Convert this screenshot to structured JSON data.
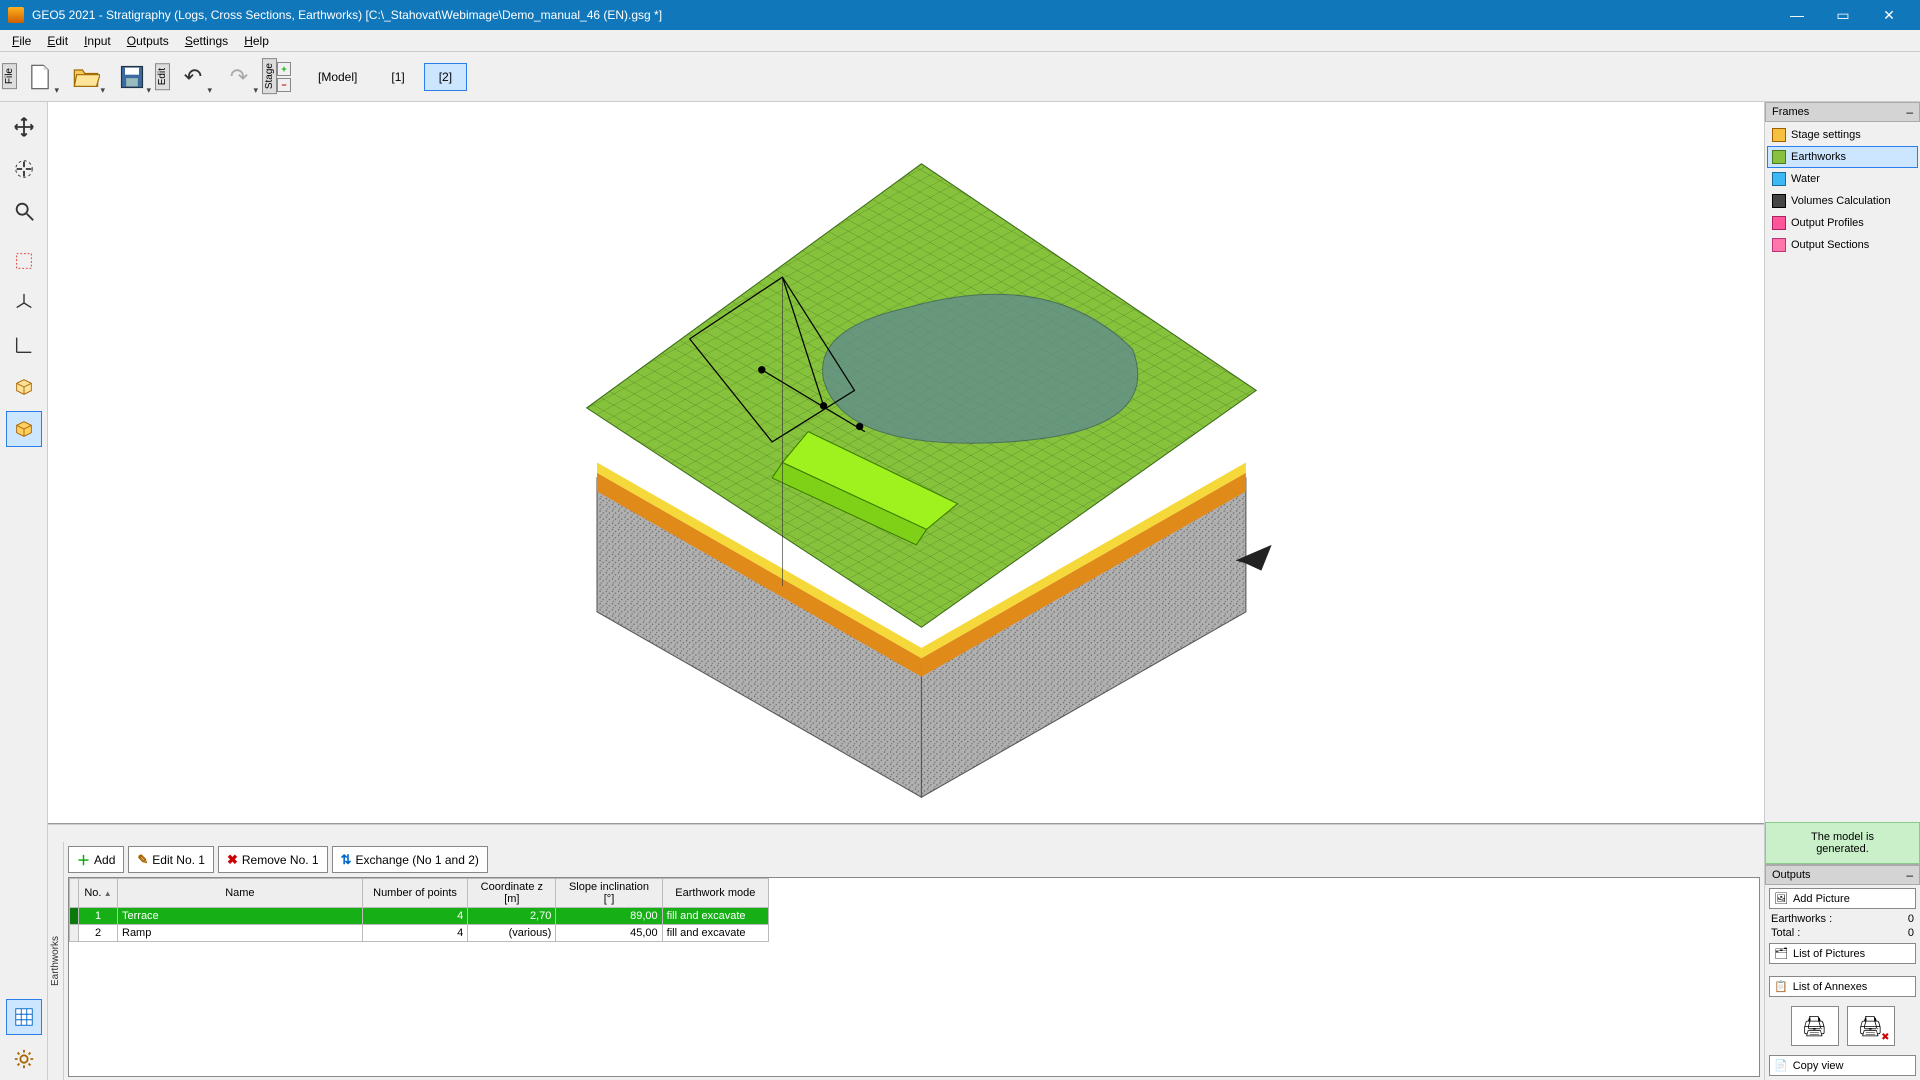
{
  "title": "GEO5 2021 - Stratigraphy (Logs, Cross Sections, Earthworks) [C:\\_Stahovat\\Webimage\\Demo_manual_46 (EN).gsg *]",
  "menu": {
    "file": "File",
    "edit": "Edit",
    "input": "Input",
    "outputs": "Outputs",
    "settings": "Settings",
    "help": "Help"
  },
  "toolbar": {
    "filetab": "File",
    "edittab": "Edit",
    "stagetab": "Stage",
    "stages": {
      "model": "[Model]",
      "s1": "[1]",
      "s2": "[2]"
    }
  },
  "frames": {
    "title": "Frames",
    "items": [
      {
        "label": "Stage settings",
        "icon": "settings-stage-icon"
      },
      {
        "label": "Earthworks",
        "icon": "earthworks-icon"
      },
      {
        "label": "Water",
        "icon": "water-icon"
      },
      {
        "label": "Volumes Calculation",
        "icon": "volumes-icon"
      },
      {
        "label": "Output Profiles",
        "icon": "profiles-icon"
      },
      {
        "label": "Output Sections",
        "icon": "sections-icon"
      }
    ],
    "selected": 1
  },
  "status": {
    "line1": "The model is",
    "line2": "generated."
  },
  "outputs": {
    "title": "Outputs",
    "addPicture": "Add Picture",
    "earthworksLabel": "Earthworks :",
    "earthworksCount": "0",
    "totalLabel": "Total :",
    "totalCount": "0",
    "listPictures": "List of Pictures",
    "listAnnexes": "List of Annexes",
    "copyView": "Copy view"
  },
  "bottom": {
    "tab": "Earthworks",
    "add": "Add",
    "edit": "Edit No. 1",
    "remove": "Remove No. 1",
    "exchange": "Exchange (No 1 and 2)",
    "cols": {
      "no": "No.",
      "name": "Name",
      "npts": "Number of points",
      "z": "Coordinate z",
      "zunit": "[m]",
      "slope": "Slope inclination",
      "slopeunit": "[°]",
      "mode": "Earthwork mode"
    },
    "rows": [
      {
        "no": "1",
        "name": "Terrace",
        "npts": "4",
        "z": "2,70",
        "slope": "89,00",
        "mode": "fill and excavate"
      },
      {
        "no": "2",
        "name": "Ramp",
        "npts": "4",
        "z": "(various)",
        "slope": "45,00",
        "mode": "fill and excavate"
      }
    ]
  }
}
